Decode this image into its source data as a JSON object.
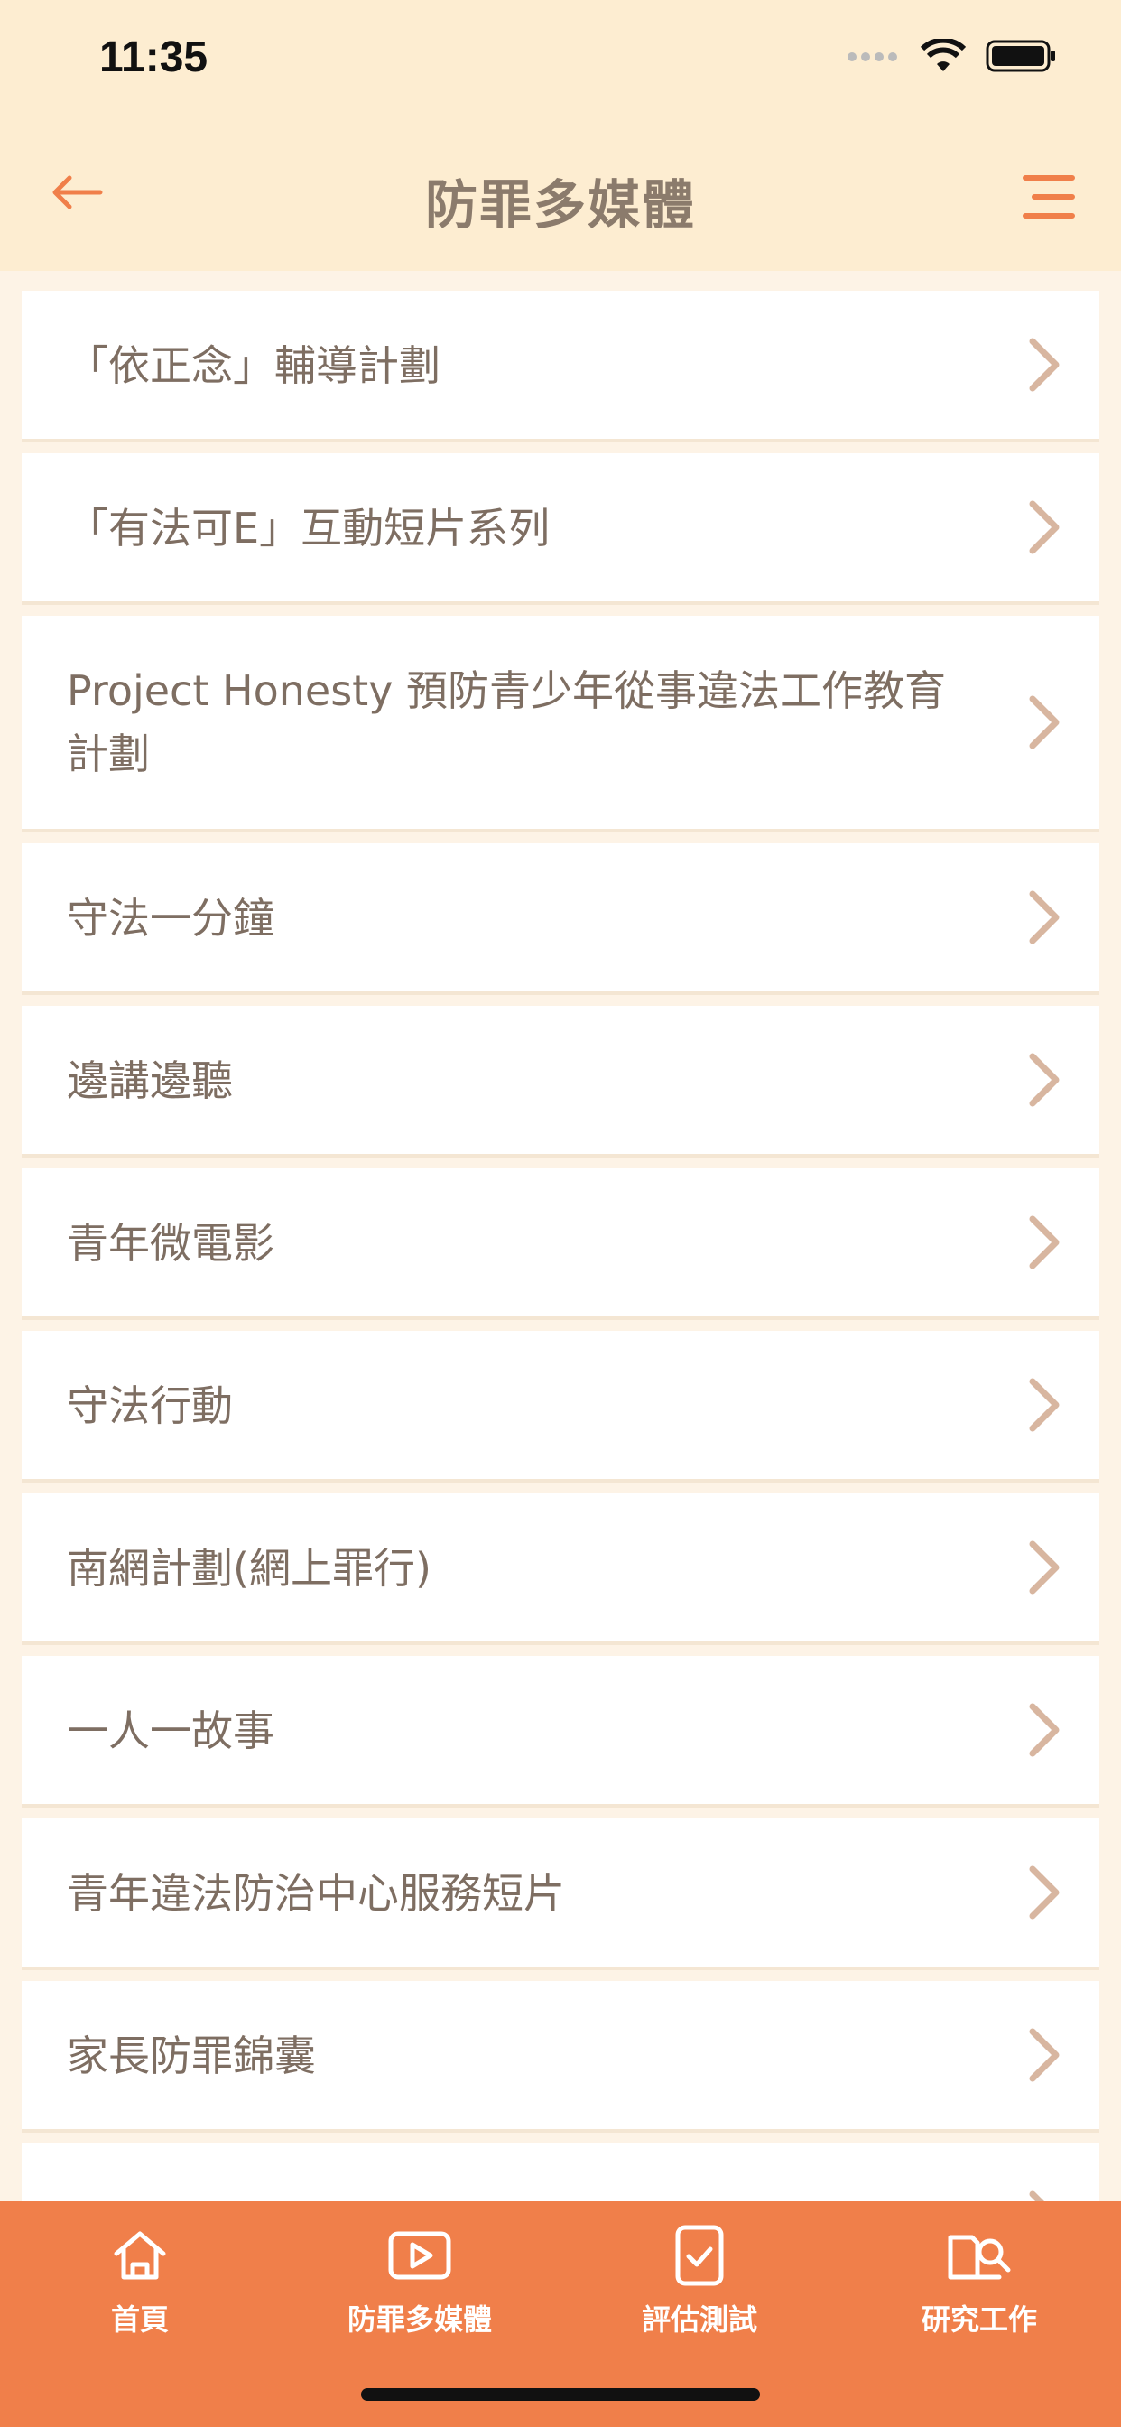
{
  "status_bar": {
    "time": "11:35"
  },
  "header": {
    "title": "防罪多媒體"
  },
  "list": [
    "「依正念」輔導計劃",
    "「有法可E」互動短片系列",
    "Project Honesty 預防青少年從事違法工作教育計劃",
    "守法一分鐘",
    "邊講邊聽",
    "青年微電影",
    "守法行動",
    "南網計劃(網上罪行)",
    "一人一故事",
    "青年違法防治中心服務短片",
    "家長防罪錦囊"
  ],
  "tabs": [
    {
      "label": "首頁",
      "icon": "home-icon"
    },
    {
      "label": "防罪多媒體",
      "icon": "video-icon"
    },
    {
      "label": "評估測試",
      "icon": "clipboard-check-icon"
    },
    {
      "label": "研究工作",
      "icon": "book-search-icon"
    }
  ],
  "colors": {
    "accent": "#f07f4a",
    "header_bg": "#fdedd1",
    "page_bg": "#fdf3e6",
    "text": "#7e6e62",
    "chevron": "#d8b6a0"
  }
}
